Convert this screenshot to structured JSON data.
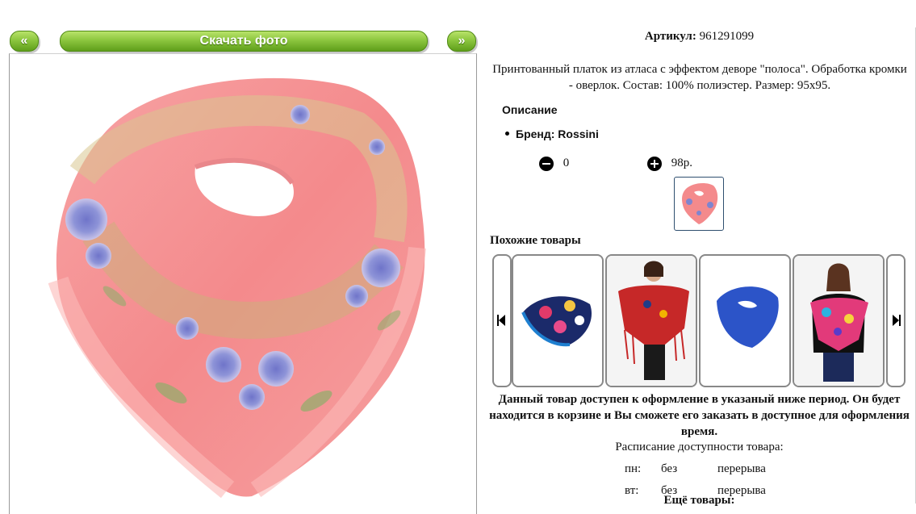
{
  "nav": {
    "prev_label": "«",
    "download_label": "Скачать фото",
    "next_label": "»"
  },
  "product": {
    "article_label": "Артикул:",
    "article_value": "961291099",
    "description": "Принтованный платок из атласа с эффектом деворе \"полоса\". Обработка кромки - оверлок. Состав: 100% полиэстер. Размер: 95x95.",
    "description_heading": "Описание",
    "brand_line": "Бренд: Rossini",
    "quantity": "0",
    "price": "98р."
  },
  "similar": {
    "heading": "Похожие товары"
  },
  "availability": {
    "notice": "Данный товар доступен к оформление в указаный ниже период. Он будет находится в корзине и Вы сможете его заказать в доступное для оформления время.",
    "schedule_heading": "Расписание доступности товара:",
    "rows": [
      {
        "day": "пн:",
        "from": "без",
        "to": "перерыва"
      },
      {
        "day": "вт:",
        "from": "без",
        "to": "перерыва"
      }
    ]
  },
  "more_heading": "Ещё товары:",
  "colors": {
    "accent_green": "#8cc63f",
    "scarf_pink": "#f48a8c"
  },
  "icons": {
    "minus": "minus-circle-icon",
    "plus": "plus-circle-icon",
    "prev": "skip-back-icon",
    "next": "skip-forward-icon"
  }
}
